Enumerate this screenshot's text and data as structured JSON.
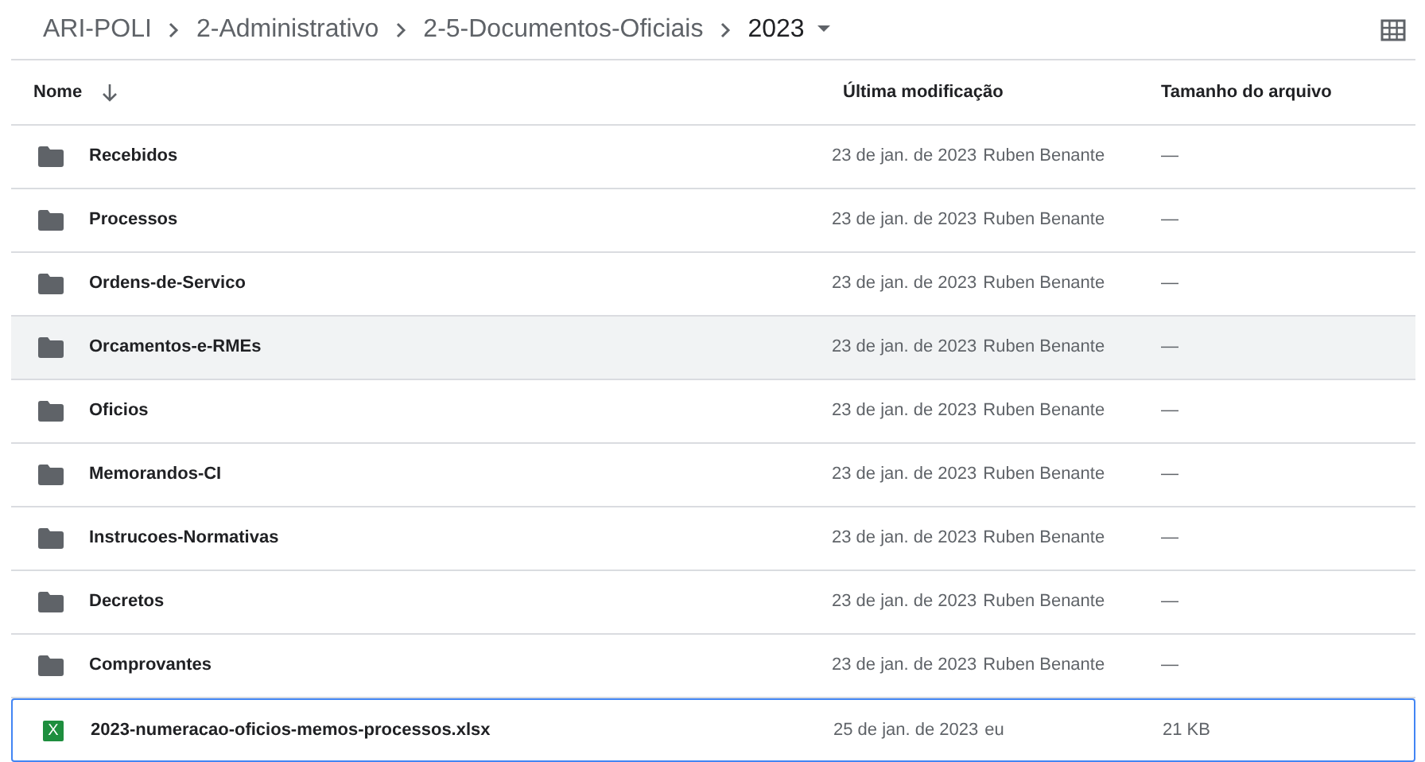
{
  "breadcrumb": [
    "ARI-POLI",
    "2-Administrativo",
    "2-5-Documentos-Oficiais",
    "2023"
  ],
  "table": {
    "columns": [
      {
        "label": "Nome",
        "sorted": true
      },
      {
        "label": "Última modificação",
        "sorted": false
      },
      {
        "label": "Tamanho do arquivo",
        "sorted": false
      }
    ],
    "rows": [
      {
        "kind": "folder",
        "name": "Recebidos",
        "date": "23 de jan. de 2023",
        "owner": "Ruben Benante",
        "size": "—",
        "hovered": false,
        "selected": false
      },
      {
        "kind": "folder",
        "name": "Processos",
        "date": "23 de jan. de 2023",
        "owner": "Ruben Benante",
        "size": "—",
        "hovered": false,
        "selected": false
      },
      {
        "kind": "folder",
        "name": "Ordens-de-Servico",
        "date": "23 de jan. de 2023",
        "owner": "Ruben Benante",
        "size": "—",
        "hovered": false,
        "selected": false
      },
      {
        "kind": "folder",
        "name": "Orcamentos-e-RMEs",
        "date": "23 de jan. de 2023",
        "owner": "Ruben Benante",
        "size": "—",
        "hovered": true,
        "selected": false
      },
      {
        "kind": "folder",
        "name": "Oficios",
        "date": "23 de jan. de 2023",
        "owner": "Ruben Benante",
        "size": "—",
        "hovered": false,
        "selected": false
      },
      {
        "kind": "folder",
        "name": "Memorandos-CI",
        "date": "23 de jan. de 2023",
        "owner": "Ruben Benante",
        "size": "—",
        "hovered": false,
        "selected": false
      },
      {
        "kind": "folder",
        "name": "Instrucoes-Normativas",
        "date": "23 de jan. de 2023",
        "owner": "Ruben Benante",
        "size": "—",
        "hovered": false,
        "selected": false
      },
      {
        "kind": "folder",
        "name": "Decretos",
        "date": "23 de jan. de 2023",
        "owner": "Ruben Benante",
        "size": "—",
        "hovered": false,
        "selected": false
      },
      {
        "kind": "folder",
        "name": "Comprovantes",
        "date": "23 de jan. de 2023",
        "owner": "Ruben Benante",
        "size": "—",
        "hovered": false,
        "selected": false
      },
      {
        "kind": "spreadsheet",
        "icon_letter": "X",
        "name": "2023-numeracao-oficios-memos-processos.xlsx",
        "date": "25 de jan. de 2023",
        "owner": "eu",
        "size": "21 KB",
        "hovered": false,
        "selected": true
      }
    ]
  }
}
